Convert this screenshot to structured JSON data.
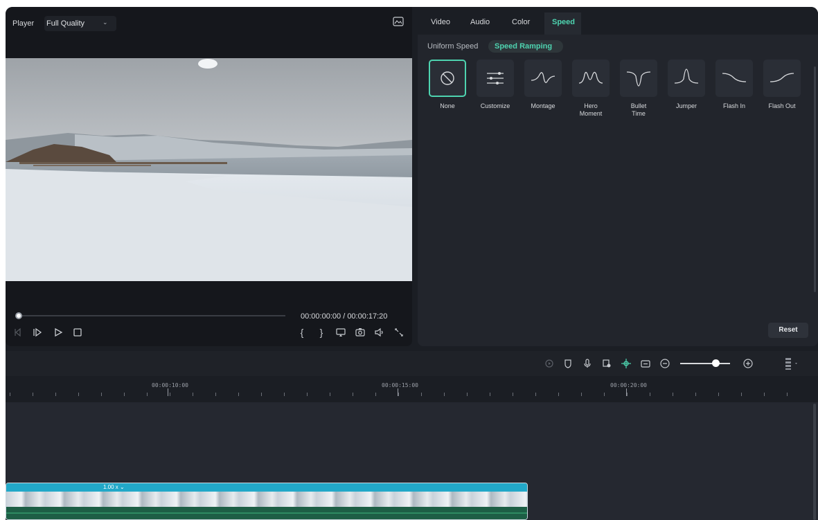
{
  "colors": {
    "accent": "#4ed4b0",
    "bg": "#1b1e24",
    "panel": "#22252c",
    "clip": "#22a8c8"
  },
  "player": {
    "title": "Player",
    "quality": "Full Quality",
    "current_time": "00:00:00:00",
    "separator": "/",
    "total_time": "00:00:17:20",
    "progress": 0
  },
  "speed_panel": {
    "tabs": [
      {
        "label": "Video",
        "active": false
      },
      {
        "label": "Audio",
        "active": false
      },
      {
        "label": "Color",
        "active": false
      },
      {
        "label": "Speed",
        "active": true
      }
    ],
    "subtabs": [
      {
        "label": "Uniform Speed",
        "active": false
      },
      {
        "label": "Speed Ramping",
        "active": true
      }
    ],
    "presets": [
      {
        "label": "None",
        "icon": "none-circle-slash-icon",
        "selected": true
      },
      {
        "label": "Customize",
        "icon": "sliders-icon",
        "selected": false
      },
      {
        "label": "Montage",
        "icon": "montage-curve-icon",
        "selected": false
      },
      {
        "label": "Hero\nMoment",
        "icon": "hero-moment-curve-icon",
        "selected": false
      },
      {
        "label": "Bullet\nTime",
        "icon": "bullet-time-curve-icon",
        "selected": false
      },
      {
        "label": "Jumper",
        "icon": "jumper-curve-icon",
        "selected": false
      },
      {
        "label": "Flash In",
        "icon": "flash-in-curve-icon",
        "selected": false
      },
      {
        "label": "Flash Out",
        "icon": "flash-out-curve-icon",
        "selected": false
      }
    ],
    "reset_label": "Reset"
  },
  "timeline": {
    "ruler_labels": [
      "00:00:10:00",
      "00:00:15:00",
      "00:00:20:00"
    ],
    "zoom_level": 0.65,
    "clip_speed": "1.00 x ⌄"
  }
}
